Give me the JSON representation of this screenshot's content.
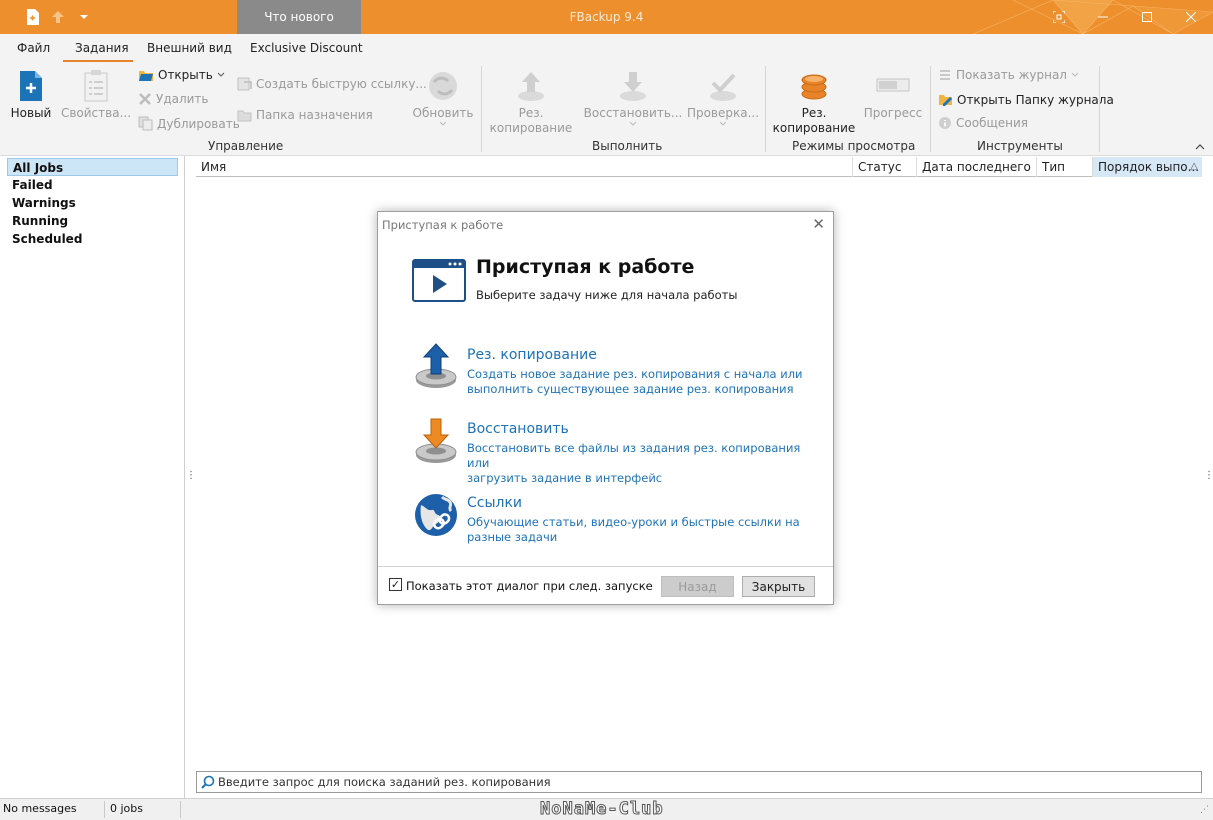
{
  "titlebar": {
    "title": "FBackup 9.4",
    "whats_new": "Что нового",
    "colors": {
      "bar": "#ed8f2c",
      "tab": "#8a8a8a"
    }
  },
  "menu": {
    "tabs": [
      "Файл",
      "Задания",
      "Внешний вид",
      "Exclusive Discount"
    ],
    "active": "Задания"
  },
  "ribbon": {
    "manage": {
      "new": "Новый",
      "props": "Свойства...",
      "open": "Открыть",
      "delete": "Удалить",
      "duplicate": "Дублировать",
      "quicklink": "Создать быструю ссылку...",
      "dest": "Папка назначения",
      "refresh": "Обновить",
      "label": "Управление"
    },
    "run": {
      "backup_l1": "Рез.",
      "backup_l2": "копирование",
      "restore": "Восстановить...",
      "verify": "Проверка...",
      "label": "Выполнить"
    },
    "views": {
      "backup_l1": "Рез.",
      "backup_l2": "копирование",
      "progress": "Прогресс",
      "label": "Режимы просмотра"
    },
    "tools": {
      "show_log": "Показать журнал",
      "open_log_folder": "Открыть Папку журнала",
      "messages": "Сообщения",
      "label": "Инструменты"
    }
  },
  "sidebar": {
    "items": [
      "All Jobs",
      "Failed",
      "Warnings",
      "Running",
      "Scheduled"
    ]
  },
  "grid": {
    "columns": [
      "Имя",
      "Статус",
      "Дата последнего ...",
      "Тип",
      "Порядок выпо..."
    ]
  },
  "search": {
    "placeholder": "Введите запрос для поиска заданий рез. копирования"
  },
  "status": {
    "messages": "No messages",
    "jobs": "0 jobs",
    "watermark": "NoNaMe-Club"
  },
  "dialog": {
    "title": "Приступая к работе",
    "heading": "Приступая к работе",
    "subtitle": "Выберите задачу ниже для начала работы",
    "options": [
      {
        "title": "Рез. копирование",
        "desc_l1": "Создать новое задание рез. копирования с начала или",
        "desc_l2": "выполнить существующее задание рез. копирования"
      },
      {
        "title": "Восстановить",
        "desc_l1": "Восстановить все файлы из задания рез. копирования или",
        "desc_l2": "загрузить задание в интерфейс"
      },
      {
        "title": "Ссылки",
        "desc_l1": "Обучающие статьи, видео-уроки и быстрые ссылки на",
        "desc_l2": "разные задачи"
      }
    ],
    "checkbox_label": "Показать этот диалог при след. запуске",
    "back": "Назад",
    "close": "Закрыть",
    "accent": "#1d73b8"
  }
}
